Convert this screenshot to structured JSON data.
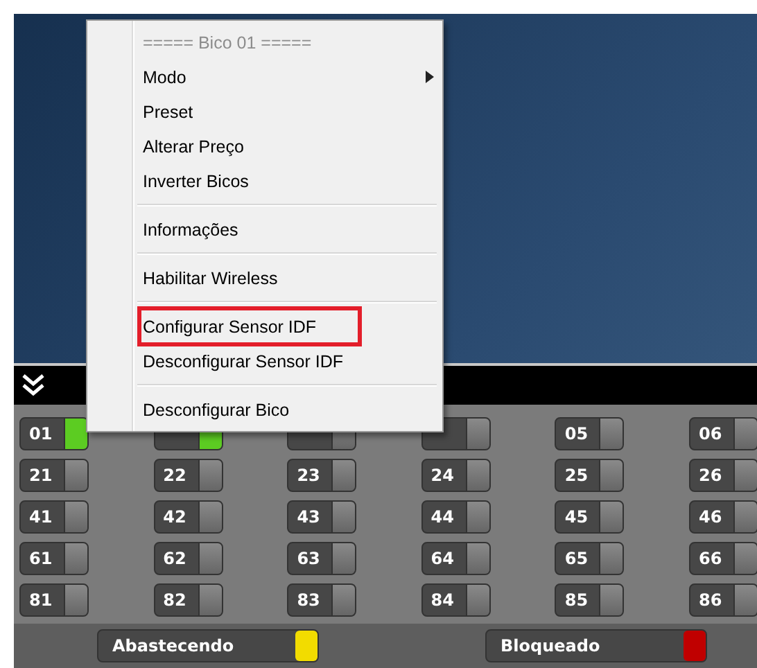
{
  "menu": {
    "items": [
      {
        "kind": "header",
        "label": "===== Bico 01 ====="
      },
      {
        "kind": "item",
        "label": "Modo",
        "submenu": true,
        "highlighted": false
      },
      {
        "kind": "item",
        "label": "Preset",
        "submenu": false,
        "highlighted": false
      },
      {
        "kind": "item",
        "label": "Alterar Preço",
        "submenu": false,
        "highlighted": false
      },
      {
        "kind": "item",
        "label": "Inverter Bicos",
        "submenu": false,
        "highlighted": false
      },
      {
        "kind": "separator"
      },
      {
        "kind": "item",
        "label": "Informações",
        "submenu": false,
        "highlighted": false
      },
      {
        "kind": "separator"
      },
      {
        "kind": "item",
        "label": "Habilitar Wireless",
        "submenu": false,
        "highlighted": false
      },
      {
        "kind": "separator"
      },
      {
        "kind": "item",
        "label": "Configurar Sensor IDF",
        "submenu": false,
        "highlighted": true
      },
      {
        "kind": "item",
        "label": "Desconfigurar Sensor IDF",
        "submenu": false,
        "highlighted": false
      },
      {
        "kind": "separator"
      },
      {
        "kind": "item",
        "label": "Desconfigurar Bico",
        "submenu": false,
        "highlighted": false
      }
    ]
  },
  "nozzles": [
    {
      "label": "01",
      "active": true
    },
    {
      "active": true
    },
    {
      "active": false
    },
    {
      "active": false
    },
    {
      "label": "05",
      "active": false
    },
    {
      "label": "06",
      "active": false
    },
    {
      "label": "21",
      "active": false
    },
    {
      "label": "22",
      "active": false
    },
    {
      "label": "23",
      "active": false
    },
    {
      "label": "24",
      "active": false
    },
    {
      "label": "25",
      "active": false
    },
    {
      "label": "26",
      "active": false
    },
    {
      "label": "41",
      "active": false
    },
    {
      "label": "42",
      "active": false
    },
    {
      "label": "43",
      "active": false
    },
    {
      "label": "44",
      "active": false
    },
    {
      "label": "45",
      "active": false
    },
    {
      "label": "46",
      "active": false
    },
    {
      "label": "61",
      "active": false
    },
    {
      "label": "62",
      "active": false
    },
    {
      "label": "63",
      "active": false
    },
    {
      "label": "64",
      "active": false
    },
    {
      "label": "65",
      "active": false
    },
    {
      "label": "66",
      "active": false
    },
    {
      "label": "81",
      "active": false
    },
    {
      "label": "82",
      "active": false
    },
    {
      "label": "83",
      "active": false
    },
    {
      "label": "84",
      "active": false
    },
    {
      "label": "85",
      "active": false
    },
    {
      "label": "86",
      "active": false
    }
  ],
  "legend": [
    {
      "label": "Abastecendo",
      "color": "#f2dc00"
    },
    {
      "label": "Bloqueado",
      "color": "#c00000"
    }
  ]
}
